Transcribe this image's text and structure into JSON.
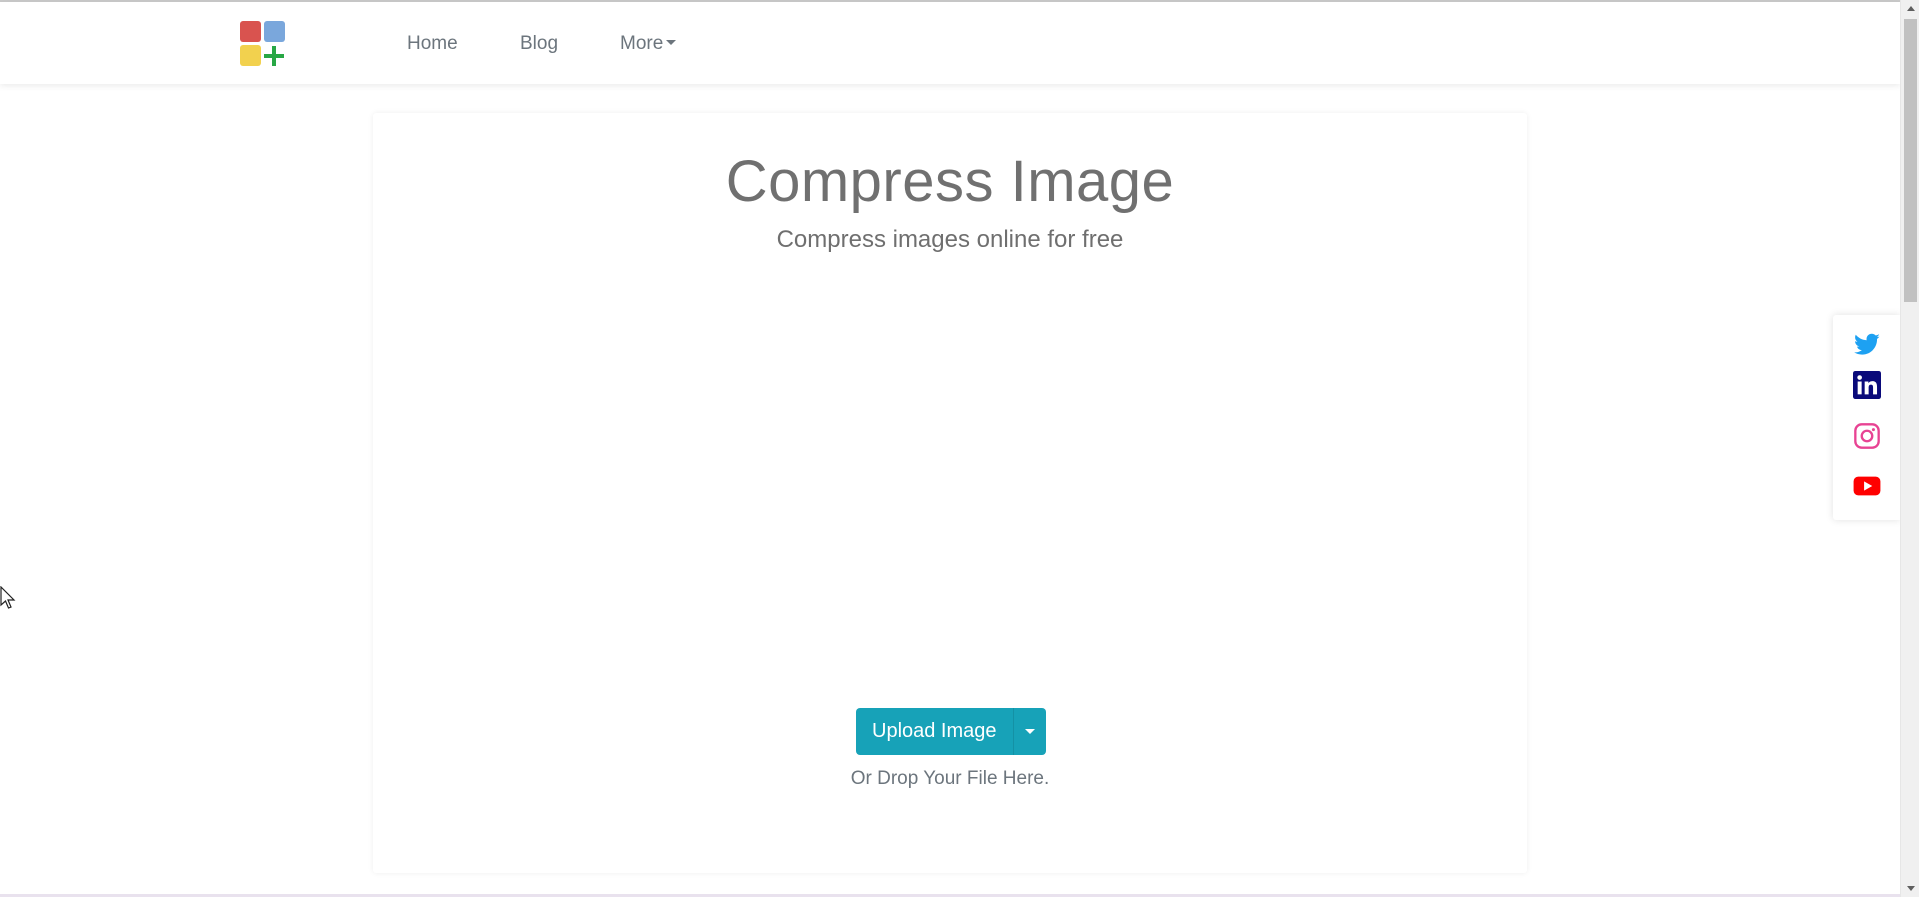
{
  "nav": {
    "logo_icon": "app-grid-plus-logo",
    "items": [
      {
        "label": "Home"
      },
      {
        "label": "Blog"
      },
      {
        "label": "More"
      }
    ]
  },
  "main": {
    "title": "Compress Image",
    "subtitle": "Compress images online for free",
    "upload_label": "Upload Image",
    "drop_text": "Or Drop Your File Here."
  },
  "social": {
    "icons": [
      "twitter-icon",
      "linkedin-icon",
      "instagram-icon",
      "youtube-icon"
    ]
  },
  "colors": {
    "accent": "#17a2b8",
    "nav_text": "#6c757d",
    "twitter": "#1da1f2",
    "linkedin": "#0a0a7a",
    "instagram": "#e84393",
    "youtube": "#ff0000",
    "logo_red": "#d9534f",
    "logo_blue": "#7aa7dc",
    "logo_yellow": "#f2d14e",
    "logo_green": "#28a745"
  }
}
